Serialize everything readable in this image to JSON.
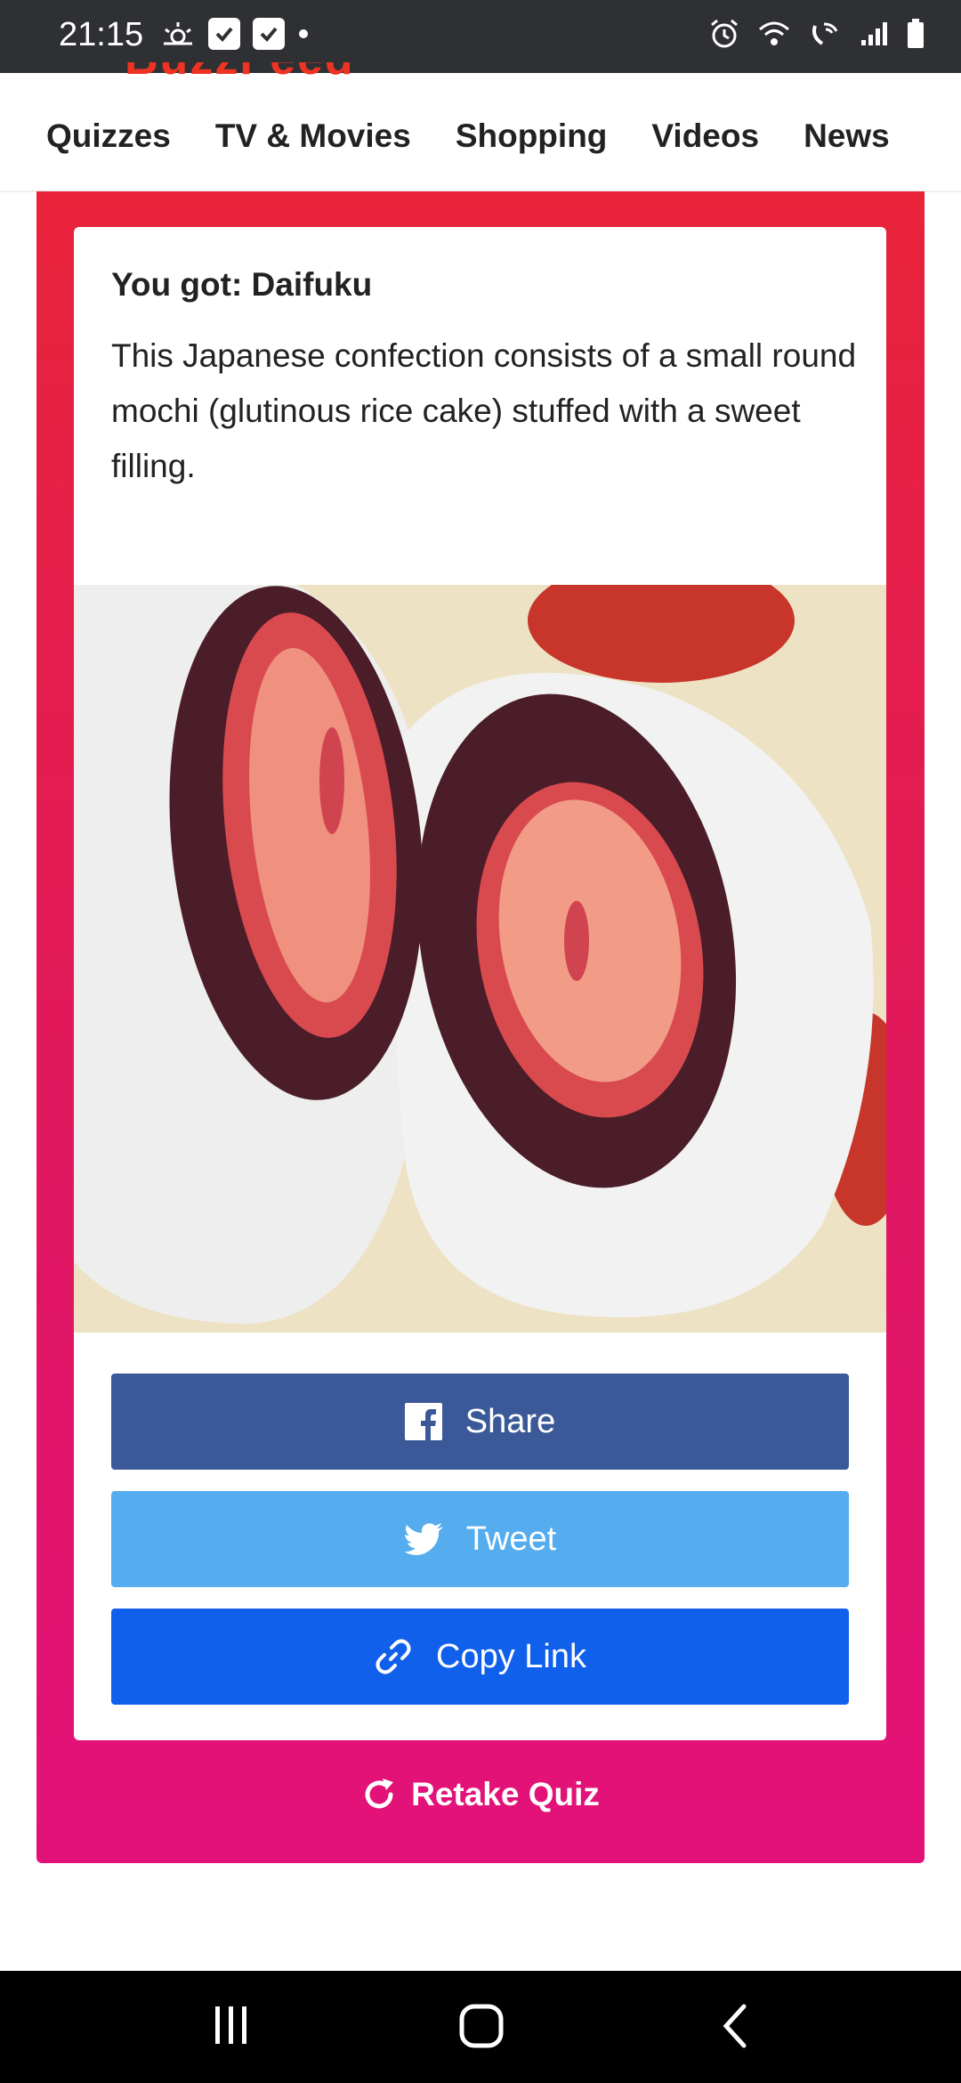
{
  "status_bar": {
    "time": "21:15"
  },
  "top_nav": {
    "logo_text": "BuzzFeed",
    "items": [
      "Quizzes",
      "TV & Movies",
      "Shopping",
      "Videos",
      "News"
    ]
  },
  "result": {
    "title": "You got: Daifuku",
    "description": "This Japanese confection consists of a small round mochi (glutinous rice cake) stuffed with a sweet filling.",
    "share_label": "Share",
    "tweet_label": "Tweet",
    "copy_label": "Copy Link",
    "retake_label": "Retake Quiz"
  },
  "colors": {
    "facebook": "#3b5998",
    "twitter": "#55acee",
    "copy_link": "#1060ec",
    "frame_top": "#e8233a",
    "frame_bottom": "#e2117a"
  }
}
